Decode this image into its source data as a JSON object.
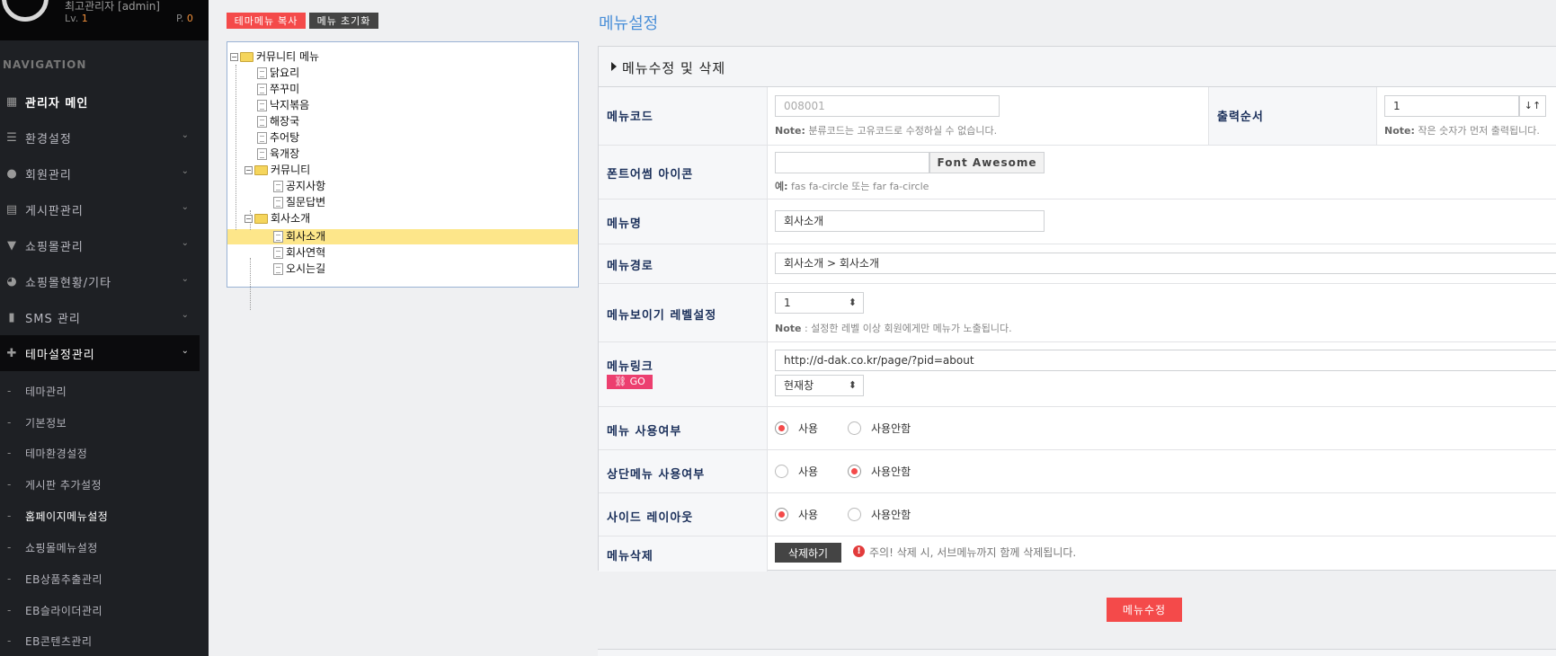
{
  "sidebar": {
    "user_name": "최고관리자 [admin]",
    "level_label": "Lv.",
    "level_value": "1",
    "point_label": "P.",
    "point_value": "0",
    "nav_title": "NAVIGATION",
    "items": [
      {
        "label": "관리자 메인",
        "icon": "dashboard-icon"
      },
      {
        "label": "환경설정",
        "icon": "sliders-icon"
      },
      {
        "label": "회원관리",
        "icon": "user-icon"
      },
      {
        "label": "게시판관리",
        "icon": "board-icon"
      },
      {
        "label": "쇼핑몰관리",
        "icon": "cart-icon"
      },
      {
        "label": "쇼핑몰현황/기타",
        "icon": "pie-chart-icon"
      },
      {
        "label": "SMS 관리",
        "icon": "mobile-icon"
      },
      {
        "label": "테마설정관리",
        "icon": "puzzle-icon"
      }
    ],
    "sub_items": [
      "테마관리",
      "기본정보",
      "테마환경설정",
      "게시판 추가설정",
      "홈페이지메뉴설정",
      "쇼핑몰메뉴설정",
      "EB상품추출관리",
      "EB슬라이더관리",
      "EB콘텐츠관리"
    ]
  },
  "toolbar": {
    "copy_label": "테마메뉴 복사",
    "reset_label": "메뉴 초기화"
  },
  "tree": {
    "root": "커뮤니티 메뉴",
    "items": [
      "닭요리",
      "쭈꾸미",
      "낙지볶음",
      "해장국",
      "추어탕",
      "육개장"
    ],
    "group1": "커뮤니티",
    "group1_items": [
      "공지사항",
      "질문답변"
    ],
    "group2": "회사소개",
    "group2_items": [
      "회사소개",
      "회사연혁",
      "오시는길"
    ]
  },
  "main": {
    "page_title": "메뉴설정",
    "panel_title": "메뉴수정 및 삭제",
    "menu_code_label": "메뉴코드",
    "menu_code_value": "008001",
    "menu_code_note_b": "Note:",
    "menu_code_note": " 분류코드는 고유코드로 수정하실 수 없습니다.",
    "order_label": "출력순서",
    "order_value": "1",
    "order_note_b": "Note:",
    "order_note": " 작은 숫자가 먼저 출력됩니다.",
    "icon_label": "폰트어썸 아이콘",
    "icon_value": "",
    "icon_btn": "Font Awesome",
    "icon_note_b": "예:",
    "icon_note": " fas fa-circle 또는 far fa-circle",
    "name_label": "메뉴명",
    "name_value": "회사소개",
    "path_label": "메뉴경로",
    "path_value": "회사소개 > 회사소개",
    "level_label": "메뉴보이기 레벨설정",
    "level_value": "1",
    "level_note_b": "Note",
    "level_note": " : 설정한 레벨 이상 회원에게만 메뉴가 노출됩니다.",
    "link_label": "메뉴링크",
    "link_go": "GO",
    "link_value": "http://d-dak.co.kr/page/?pid=about",
    "target_value": "현재창",
    "use_label": "메뉴 사용여부",
    "top_use_label": "상단메뉴 사용여부",
    "side_label": "사이드 레이아웃",
    "opt_use": "사용",
    "opt_nouse": "사용안함",
    "delete_label": "메뉴삭제",
    "delete_btn": "삭제하기",
    "delete_warn": "주의! 삭제 시, 서브메뉴까지 함께 삭제됩니다.",
    "save_btn": "메뉴수정"
  },
  "colors": {
    "accent": "#f44a4a",
    "title_blue": "#4a8fd8",
    "label_navy": "#1a2f5a"
  }
}
